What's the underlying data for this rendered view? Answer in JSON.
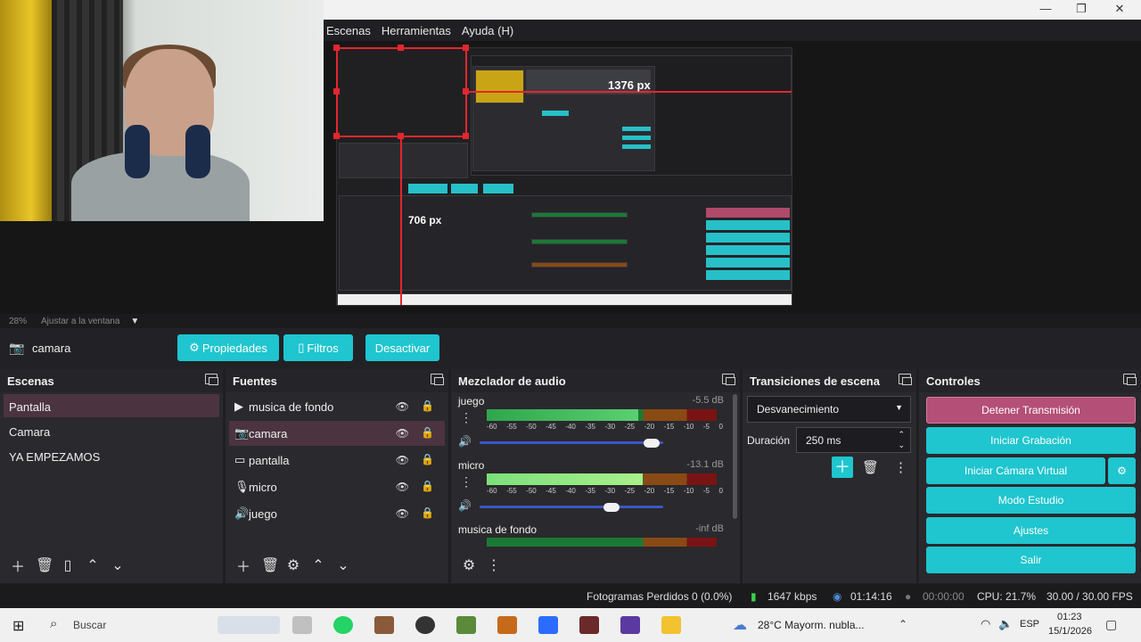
{
  "window": {
    "menu": [
      "Escenas",
      "Herramientas",
      "Ayuda (H)"
    ],
    "controls": [
      "—",
      "❐",
      "✕"
    ]
  },
  "preview": {
    "label_h": "1376 px",
    "label_v": "706 px",
    "zoom": "28%",
    "fit": "Ajustar a la ventana"
  },
  "source_bar": {
    "name": "camara",
    "properties": "Propiedades",
    "filters": "Filtros",
    "deactivate": "Desactivar"
  },
  "scenes": {
    "title": "Escenas",
    "items": [
      "Pantalla",
      "Camara",
      "YA EMPEZAMOS"
    ],
    "selected": 0
  },
  "sources": {
    "title": "Fuentes",
    "items": [
      {
        "icon": "play-icon",
        "label": "musica de fondo"
      },
      {
        "icon": "camera-icon",
        "label": "camara"
      },
      {
        "icon": "monitor-icon",
        "label": "pantalla"
      },
      {
        "icon": "microphone-icon",
        "label": "micro"
      },
      {
        "icon": "speaker-icon",
        "label": "juego"
      }
    ],
    "selected": 1
  },
  "mixer": {
    "title": "Mezclador de audio",
    "ticks": [
      "-60",
      "-55",
      "-50",
      "-45",
      "-40",
      "-35",
      "-30",
      "-25",
      "-20",
      "-15",
      "-10",
      "-5",
      "0"
    ],
    "channels": [
      {
        "name": "juego",
        "db": "-5.5 dB",
        "level": 0.66,
        "volume": 0.98
      },
      {
        "name": "micro",
        "db": "-13.1 dB",
        "level": 0.68,
        "volume": 0.76
      },
      {
        "name": "musica de fondo",
        "db": "-inf dB",
        "level": 0.0,
        "volume": 0.0
      }
    ]
  },
  "transitions": {
    "title": "Transiciones de escena",
    "selected": "Desvanecimiento",
    "duration_label": "Duración",
    "duration_value": "250 ms"
  },
  "controls": {
    "title": "Controles",
    "buttons": [
      "Detener Transmisión",
      "Iniciar Grabación",
      "Iniciar Cámara Virtual",
      "Modo Estudio",
      "Ajustes",
      "Salir"
    ]
  },
  "status": {
    "dropped": "Fotogramas Perdidos 0 (0.0%)",
    "bitrate": "1647 kbps",
    "stream_time": "01:14:16",
    "rec_time": "00:00:00",
    "cpu": "CPU: 21.7%",
    "fps": "30.00 / 30.00 FPS"
  },
  "taskbar": {
    "search": "Buscar",
    "weather": "28°C  Mayorm. nubla...",
    "lang": "ESP",
    "time": "01:23",
    "date": "15/1/2026"
  },
  "colors": {
    "accent": "#1fc5cf",
    "stop": "#b44f77",
    "selected": "#4b3440",
    "guide": "#e3262f"
  }
}
